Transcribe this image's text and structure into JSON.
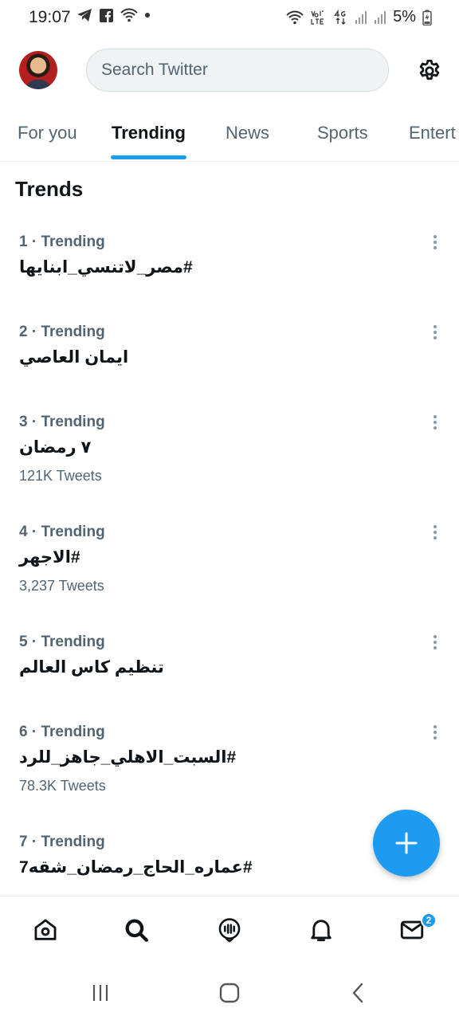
{
  "status_bar": {
    "time": "19:07",
    "battery_text": "5%"
  },
  "header": {
    "search_placeholder": "Search Twitter"
  },
  "tabs": [
    {
      "label": "For you",
      "active": false
    },
    {
      "label": "Trending",
      "active": true
    },
    {
      "label": "News",
      "active": false
    },
    {
      "label": "Sports",
      "active": false
    },
    {
      "label": "Entert",
      "active": false
    }
  ],
  "section_title": "Trends",
  "trends": [
    {
      "meta": "1 · Trending",
      "name": "#مصر_لاتنسي_ابنايها",
      "count": ""
    },
    {
      "meta": "2 · Trending",
      "name": "ايمان العاصي",
      "count": ""
    },
    {
      "meta": "3 · Trending",
      "name": "٧ رمضان",
      "count": "121K Tweets"
    },
    {
      "meta": "4 · Trending",
      "name": "#الاجهر",
      "count": "3,237 Tweets"
    },
    {
      "meta": "5 · Trending",
      "name": "تنظيم كاس العالم",
      "count": ""
    },
    {
      "meta": "6 · Trending",
      "name": "#السبت_الاهلي_جاهز_للرد",
      "count": "78.3K Tweets"
    },
    {
      "meta": "7 · Trending",
      "name": "#عماره_الحاج_رمضان_شقه7",
      "count": ""
    }
  ],
  "bottom_nav": {
    "messages_badge": "2",
    "items": [
      "home-icon",
      "search-icon",
      "spaces-icon",
      "notifications-icon",
      "messages-icon"
    ]
  },
  "colors": {
    "accent": "#1d9bf0",
    "text_primary": "#0f1419",
    "text_secondary": "#536471"
  }
}
